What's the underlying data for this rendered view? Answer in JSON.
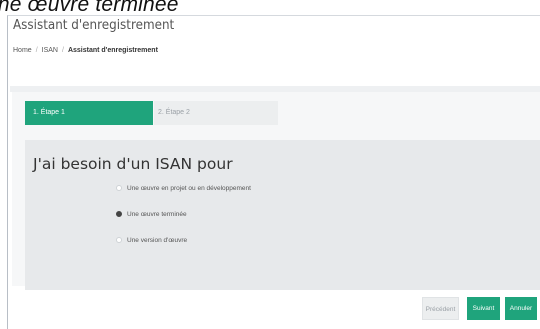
{
  "caption": "une œuvre terminée",
  "header": {
    "title": "Assistant d'enregistrement",
    "breadcrumb": [
      "Home",
      "ISAN",
      "Assistant d'enregistrement"
    ]
  },
  "steps": [
    {
      "label": "1. Étape 1",
      "active": true
    },
    {
      "label": "2. Étape 2",
      "active": false
    }
  ],
  "form": {
    "heading": "J'ai besoin d'un ISAN pour",
    "options": [
      {
        "label": "Une œuvre en projet ou en développement",
        "checked": false
      },
      {
        "label": "Une œuvre terminée",
        "checked": true
      },
      {
        "label": "Une version d'œuvre",
        "checked": false
      }
    ]
  },
  "buttons": {
    "previous": "Précédent",
    "next": "Suivant",
    "cancel": "Annuler"
  },
  "colors": {
    "accent": "#1fa47c",
    "panel": "#e7e9eb",
    "inactive_step": "#eceeef"
  }
}
